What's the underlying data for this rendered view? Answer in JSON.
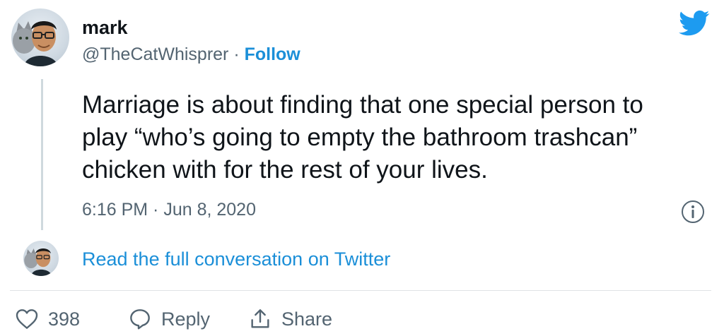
{
  "author": {
    "name": "mark",
    "handle": "@TheCatWhisprer",
    "separator": " · ",
    "follow_label": "Follow"
  },
  "tweet": {
    "lines": [
      "Marriage is about finding that one special person to",
      "play “who’s going to empty the bathroom trashcan”",
      "chicken with for the rest of your lives."
    ],
    "timestamp": "6:16 PM · Jun 8, 2020"
  },
  "conversation": {
    "link_text": "Read the full conversation on Twitter"
  },
  "actions": {
    "likes": "398",
    "reply_label": "Reply",
    "share_label": "Share"
  },
  "icons": {
    "brand": "twitter-bird-icon",
    "info": "info-icon",
    "like": "heart-icon",
    "reply": "speech-bubble-icon",
    "share": "share-upload-icon"
  },
  "colors": {
    "link": "#1b8fd8",
    "brand": "#1d9bf0",
    "text": "#0f1419",
    "muted": "#536471"
  }
}
